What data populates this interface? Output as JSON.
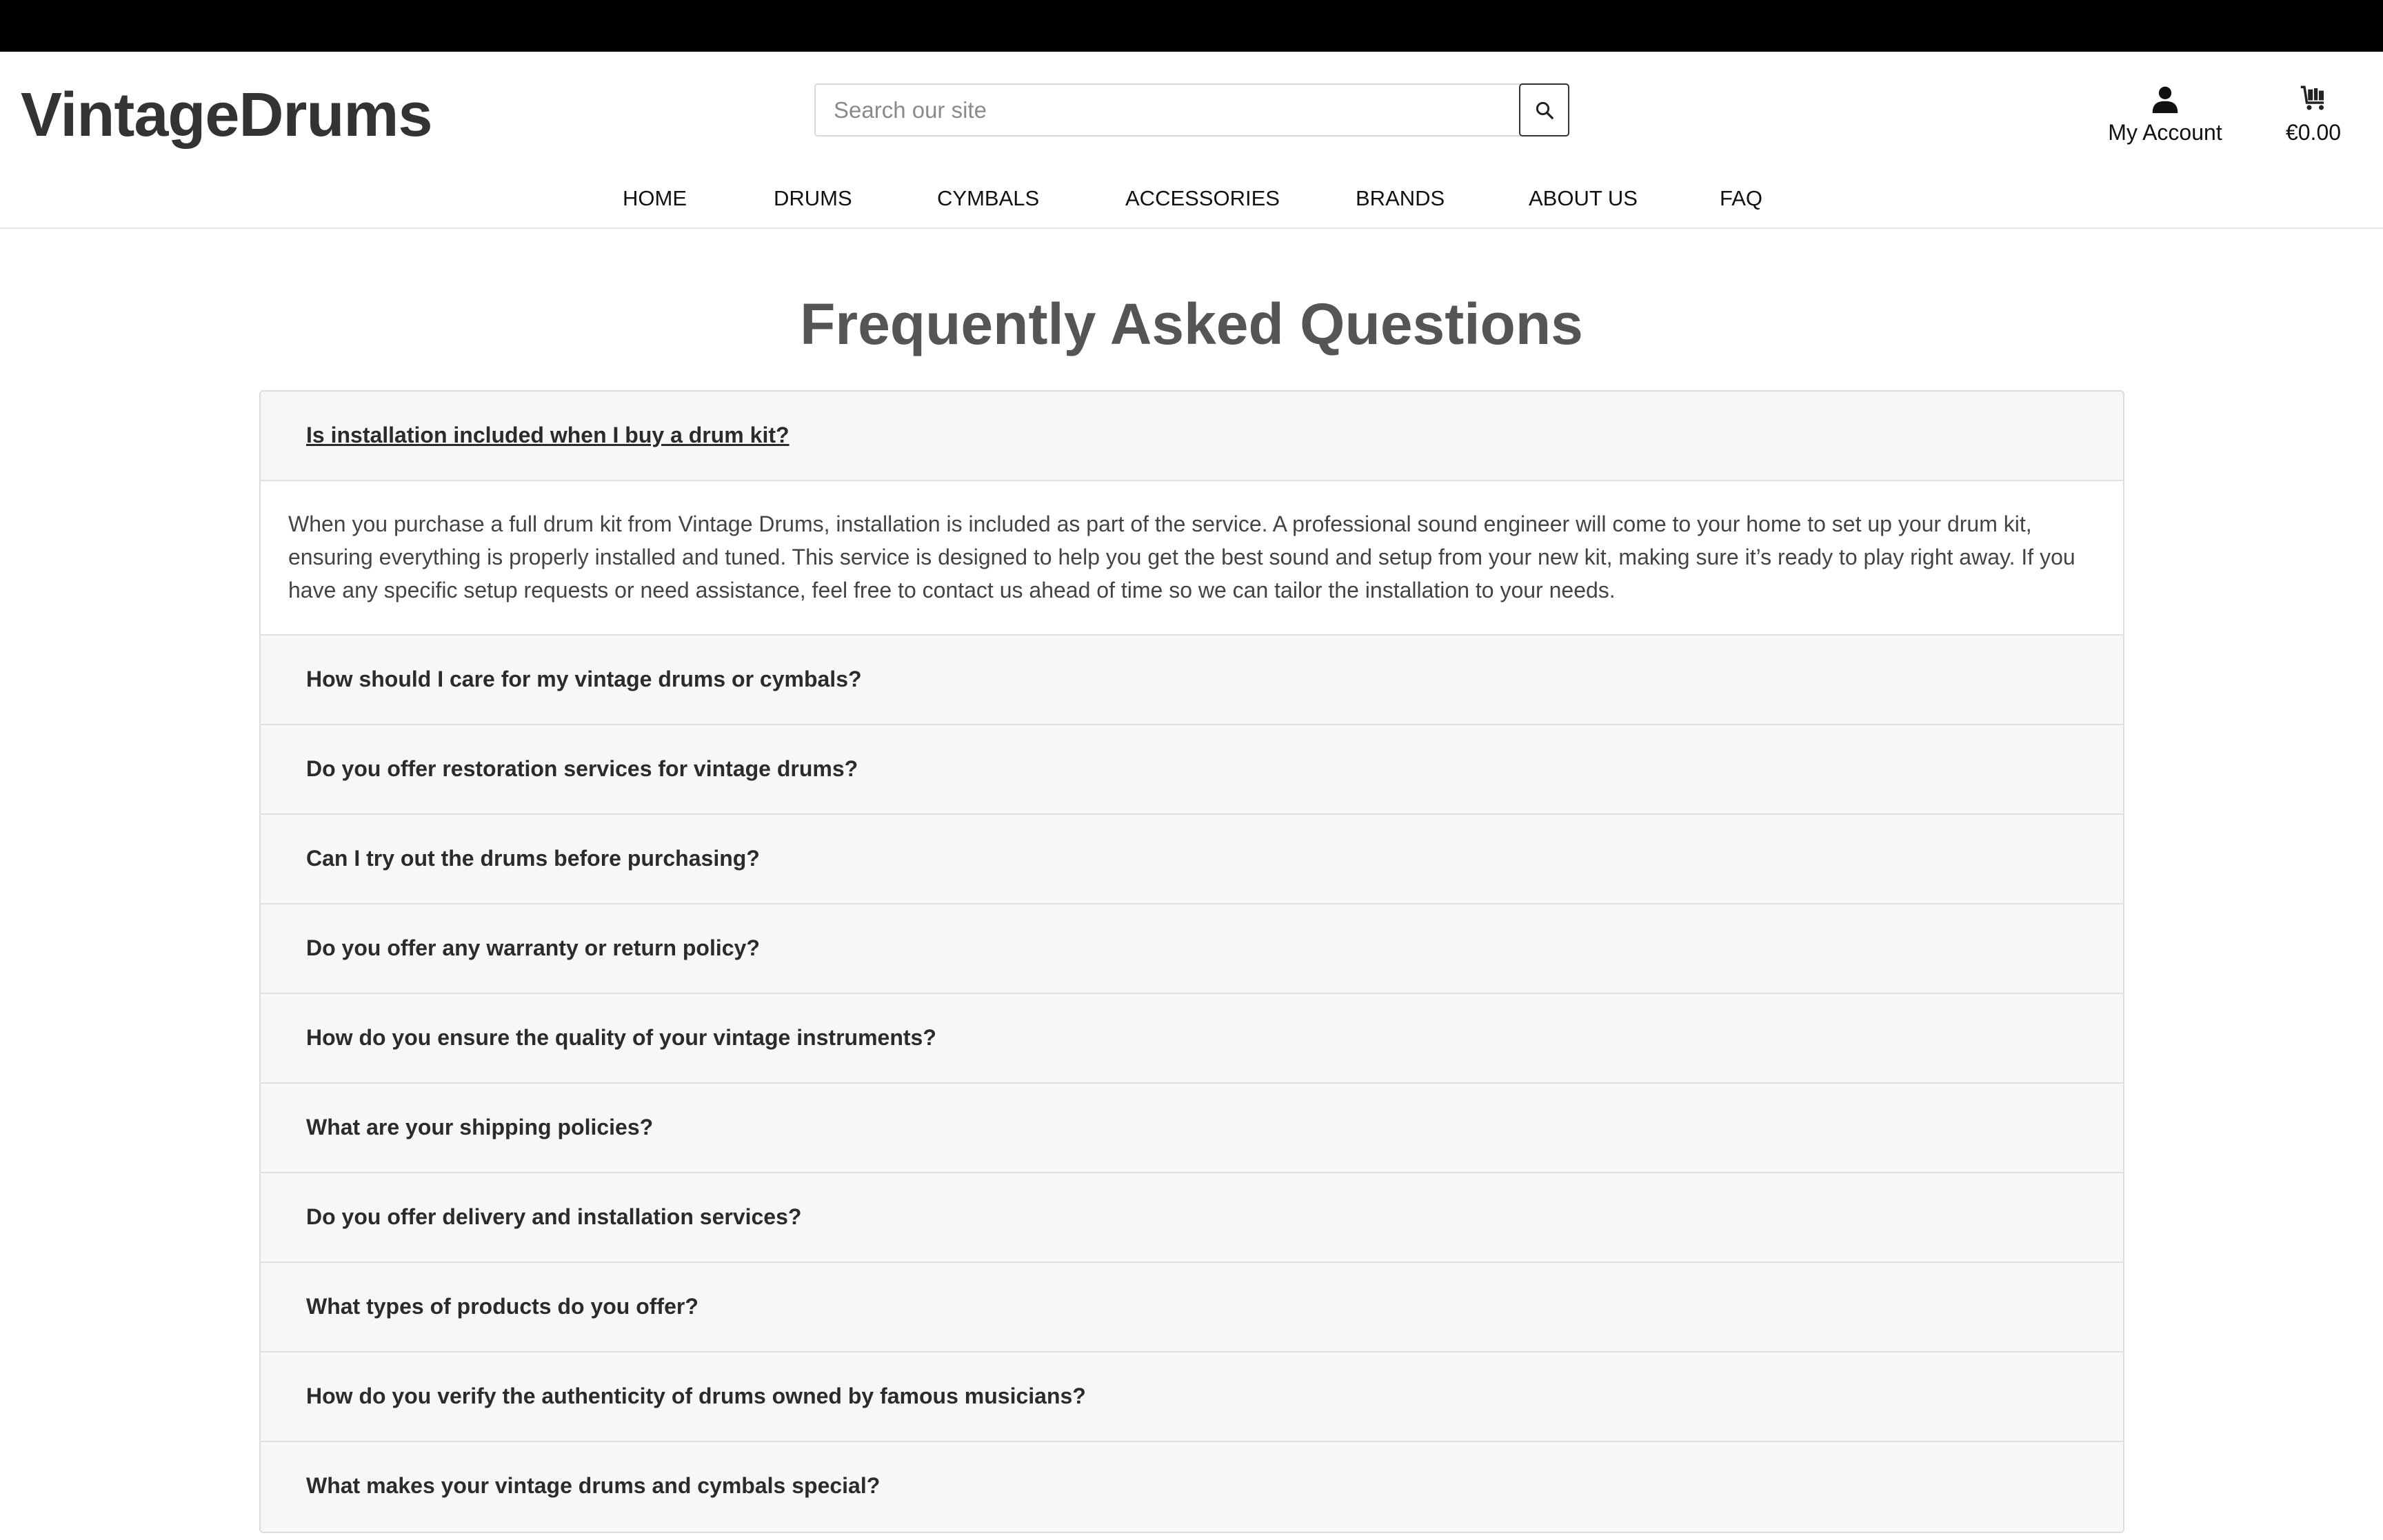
{
  "header": {
    "logo": "VintageDrums",
    "search_placeholder": "Search our site",
    "account_label": "My Account",
    "cart_total": "€0.00"
  },
  "nav": {
    "items": [
      "HOME",
      "DRUMS",
      "CYMBALS",
      "ACCESSORIES",
      "BRANDS",
      "ABOUT US",
      "FAQ"
    ]
  },
  "main": {
    "title": "Frequently Asked Questions",
    "faq": [
      {
        "question": "Is installation included when I buy a drum kit?",
        "answer": "When you purchase a full drum kit from Vintage Drums, installation is included as part of the service. A professional sound engineer will come to your home to set up your drum kit, ensuring everything is properly installed and tuned. This service is designed to help you get the best sound and setup from your new kit, making sure it’s ready to play right away. If you have any specific setup requests or need assistance, feel free to contact us ahead of time so we can tailor the installation to your needs.",
        "expanded": true
      },
      {
        "question": "How should I care for my vintage drums or cymbals?"
      },
      {
        "question": "Do you offer restoration services for vintage drums?"
      },
      {
        "question": "Can I try out the drums before purchasing?"
      },
      {
        "question": "Do you offer any warranty or return policy?"
      },
      {
        "question": "How do you ensure the quality of your vintage instruments?"
      },
      {
        "question": "What are your shipping policies?"
      },
      {
        "question": "Do you offer delivery and installation services?"
      },
      {
        "question": "What types of products do you offer?"
      },
      {
        "question": "How do you verify the authenticity of drums owned by famous musicians?"
      },
      {
        "question": "What makes your vintage drums and cymbals special?"
      }
    ]
  },
  "icons": {
    "search": "search-icon",
    "account": "user-icon",
    "cart": "cart-icon"
  },
  "colors": {
    "topbar": "#000000",
    "text": "#333333",
    "faq_header_bg": "#f7f7f7"
  }
}
